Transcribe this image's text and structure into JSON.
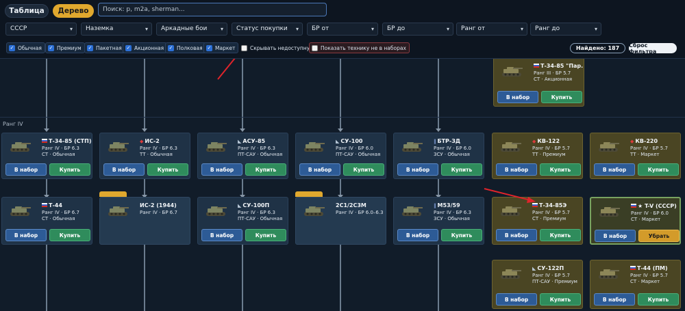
{
  "header": {
    "view_table": "Таблица",
    "view_tree": "Дерево",
    "search_placeholder": "Поиск: р, m2a, sherman..."
  },
  "filters": [
    {
      "label": "СССР"
    },
    {
      "label": "Наземка"
    },
    {
      "label": "Аркадные бои"
    },
    {
      "label": "Статус покупки"
    },
    {
      "label": "БР от"
    },
    {
      "label": "БР до"
    },
    {
      "label": "Ранг от"
    },
    {
      "label": "Ранг до"
    }
  ],
  "checkboxes": [
    {
      "label": "Обычная",
      "checked": true
    },
    {
      "label": "Премиум",
      "checked": true
    },
    {
      "label": "Пакетная",
      "checked": true
    },
    {
      "label": "Акционная",
      "checked": true
    },
    {
      "label": "Полковая",
      "checked": true
    },
    {
      "label": "Маркет",
      "checked": true
    },
    {
      "label": "Скрывать недоступную",
      "checked": false
    },
    {
      "label": "Показать технику не в наборах",
      "checked": false
    }
  ],
  "found": "Найдено: 187",
  "reset": "Сброс фильтра",
  "rank_label": "Ранг IV",
  "buttons": {
    "set": "В набор",
    "buy": "Купить",
    "remove": "Убрать"
  },
  "cards": [
    {
      "id": "t34-85-par",
      "name": "Т-34-85 \"Пар...",
      "icon": "flag",
      "line1": "Ранг III · БР 5.7",
      "line2": "СТ · Акционная",
      "style": "gold",
      "buttons": true
    },
    {
      "id": "t34-85-stp",
      "name": "Т-34-85 (СТП)",
      "icon": "flag",
      "line1": "Ранг IV · БР 6.3",
      "line2": "СТ · Обычная",
      "style": "",
      "buttons": true
    },
    {
      "id": "is2",
      "name": "ИС-2",
      "icon": "ussr",
      "line1": "Ранг IV · БР 6.3",
      "line2": "ТТ · Обычная",
      "style": "",
      "buttons": true
    },
    {
      "id": "asu85",
      "name": "АСУ-85",
      "icon": "td",
      "line1": "Ранг IV · БР 6.3",
      "line2": "ПТ-САУ · Обычная",
      "style": "",
      "buttons": true
    },
    {
      "id": "su100",
      "name": "СУ-100",
      "icon": "td",
      "line1": "Ранг IV · БР 6.0",
      "line2": "ПТ-САУ · Обычная",
      "style": "",
      "buttons": true
    },
    {
      "id": "btr3d",
      "name": "БТР-ЗД",
      "icon": "aa",
      "line1": "Ранг IV · БР 6.0",
      "line2": "ЗСУ · Обычная",
      "style": "",
      "buttons": true
    },
    {
      "id": "kv122",
      "name": "КВ-122",
      "icon": "ussr",
      "line1": "Ранг IV · БР 5.7",
      "line2": "ТТ · Премиум",
      "style": "gold",
      "buttons": true
    },
    {
      "id": "kv220",
      "name": "КВ-220",
      "icon": "ussr",
      "line1": "Ранг IV · БР 5.7",
      "line2": "ТТ · Маркет",
      "style": "gold",
      "buttons": true
    },
    {
      "id": "t44",
      "name": "Т-44",
      "icon": "flag",
      "line1": "Ранг IV · БР 6.7",
      "line2": "СТ · Обычная",
      "style": "",
      "buttons": true
    },
    {
      "id": "is2-1944",
      "name": "ИС-2 (1944)",
      "icon": "",
      "line1": "Ранг IV · БР 6.7",
      "line2": "",
      "style": "group",
      "buttons": false
    },
    {
      "id": "su100p",
      "name": "СУ-100П",
      "icon": "td",
      "line1": "Ранг IV · БР 6.3",
      "line2": "ПТ-САУ · Обычная",
      "style": "",
      "buttons": true
    },
    {
      "id": "2s1",
      "name": "2С1/2С3М",
      "icon": "",
      "line1": "Ранг IV · БР 6.0–6.3",
      "line2": "",
      "style": "group",
      "buttons": false
    },
    {
      "id": "m53",
      "name": "М53/59",
      "icon": "aa",
      "line1": "Ранг IV · БР 6.3",
      "line2": "ЗСУ · Обычная",
      "style": "",
      "buttons": true
    },
    {
      "id": "t34-85e",
      "name": "Т-34-85Э",
      "icon": "flag",
      "line1": "Ранг IV · БР 5.7",
      "line2": "СТ · Премиум",
      "style": "gold",
      "buttons": true
    },
    {
      "id": "tv",
      "name": "★ T-V (СССР)",
      "icon": "flag",
      "line1": "Ранг IV · БР 6.0",
      "line2": "СТ · Маркет",
      "style": "green",
      "buttons": true,
      "remove": true
    },
    {
      "id": "su122p",
      "name": "СУ-122П",
      "icon": "td",
      "line1": "Ранг IV · БР 5.7",
      "line2": "ПТ-САУ · Премиум",
      "style": "gold",
      "buttons": true
    },
    {
      "id": "t44pm",
      "name": "Т-44 (ПМ)",
      "icon": "flag",
      "line1": "Ранг IV · БР 5.7",
      "line2": "СТ · Маркет",
      "style": "gold",
      "buttons": true
    }
  ]
}
